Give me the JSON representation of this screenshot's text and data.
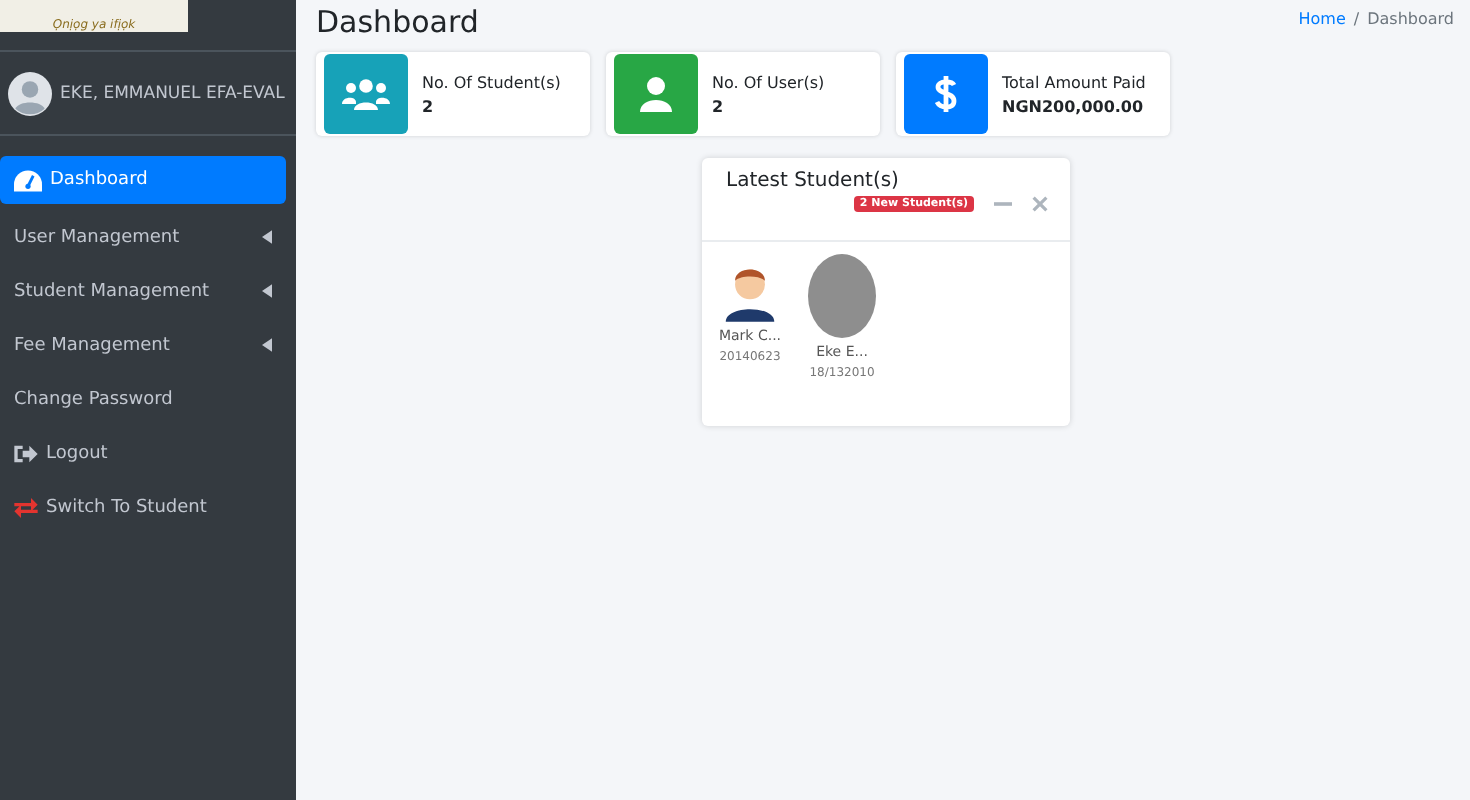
{
  "sidebar": {
    "logo_caption": "Ọnịọg ya ifịọk",
    "user": {
      "name": "EKE, EMMANUEL EFA-EVAL"
    },
    "items": [
      {
        "label": "Dashboard",
        "kind": "dashboard",
        "selected": true,
        "has_submenu": false
      },
      {
        "label": "User Management",
        "kind": "plain",
        "selected": false,
        "has_submenu": true
      },
      {
        "label": "Student Management",
        "kind": "plain",
        "selected": false,
        "has_submenu": true
      },
      {
        "label": "Fee Management",
        "kind": "plain",
        "selected": false,
        "has_submenu": true
      },
      {
        "label": "Change Password",
        "kind": "plain",
        "selected": false,
        "has_submenu": false
      },
      {
        "label": "Logout",
        "kind": "logout",
        "selected": false,
        "has_submenu": false
      },
      {
        "label": "Switch To Student",
        "kind": "switch",
        "selected": false,
        "has_submenu": false
      }
    ]
  },
  "header": {
    "title": "Dashboard",
    "separator": "/",
    "breadcrumb": [
      {
        "label": "Home",
        "kind": "link"
      },
      {
        "label": "Dashboard",
        "kind": "current"
      }
    ]
  },
  "info_boxes": [
    {
      "label": "No. Of Student(s)",
      "value": "2",
      "kind": "users",
      "color": "#17a2b8"
    },
    {
      "label": "No. Of User(s)",
      "value": "2",
      "kind": "user",
      "color": "#28a745"
    },
    {
      "label": "Total Amount Paid",
      "value": "NGN200,000.00",
      "kind": "dollar",
      "color": "#007bff"
    }
  ],
  "latest_students": {
    "title": "Latest Student(s)",
    "badge": "2 New Student(s)",
    "students": [
      {
        "name": "Mark C...",
        "id": "20140623",
        "kind": "avatar"
      },
      {
        "name": "Eke E...",
        "id": "18/132010",
        "kind": "photo"
      }
    ]
  }
}
